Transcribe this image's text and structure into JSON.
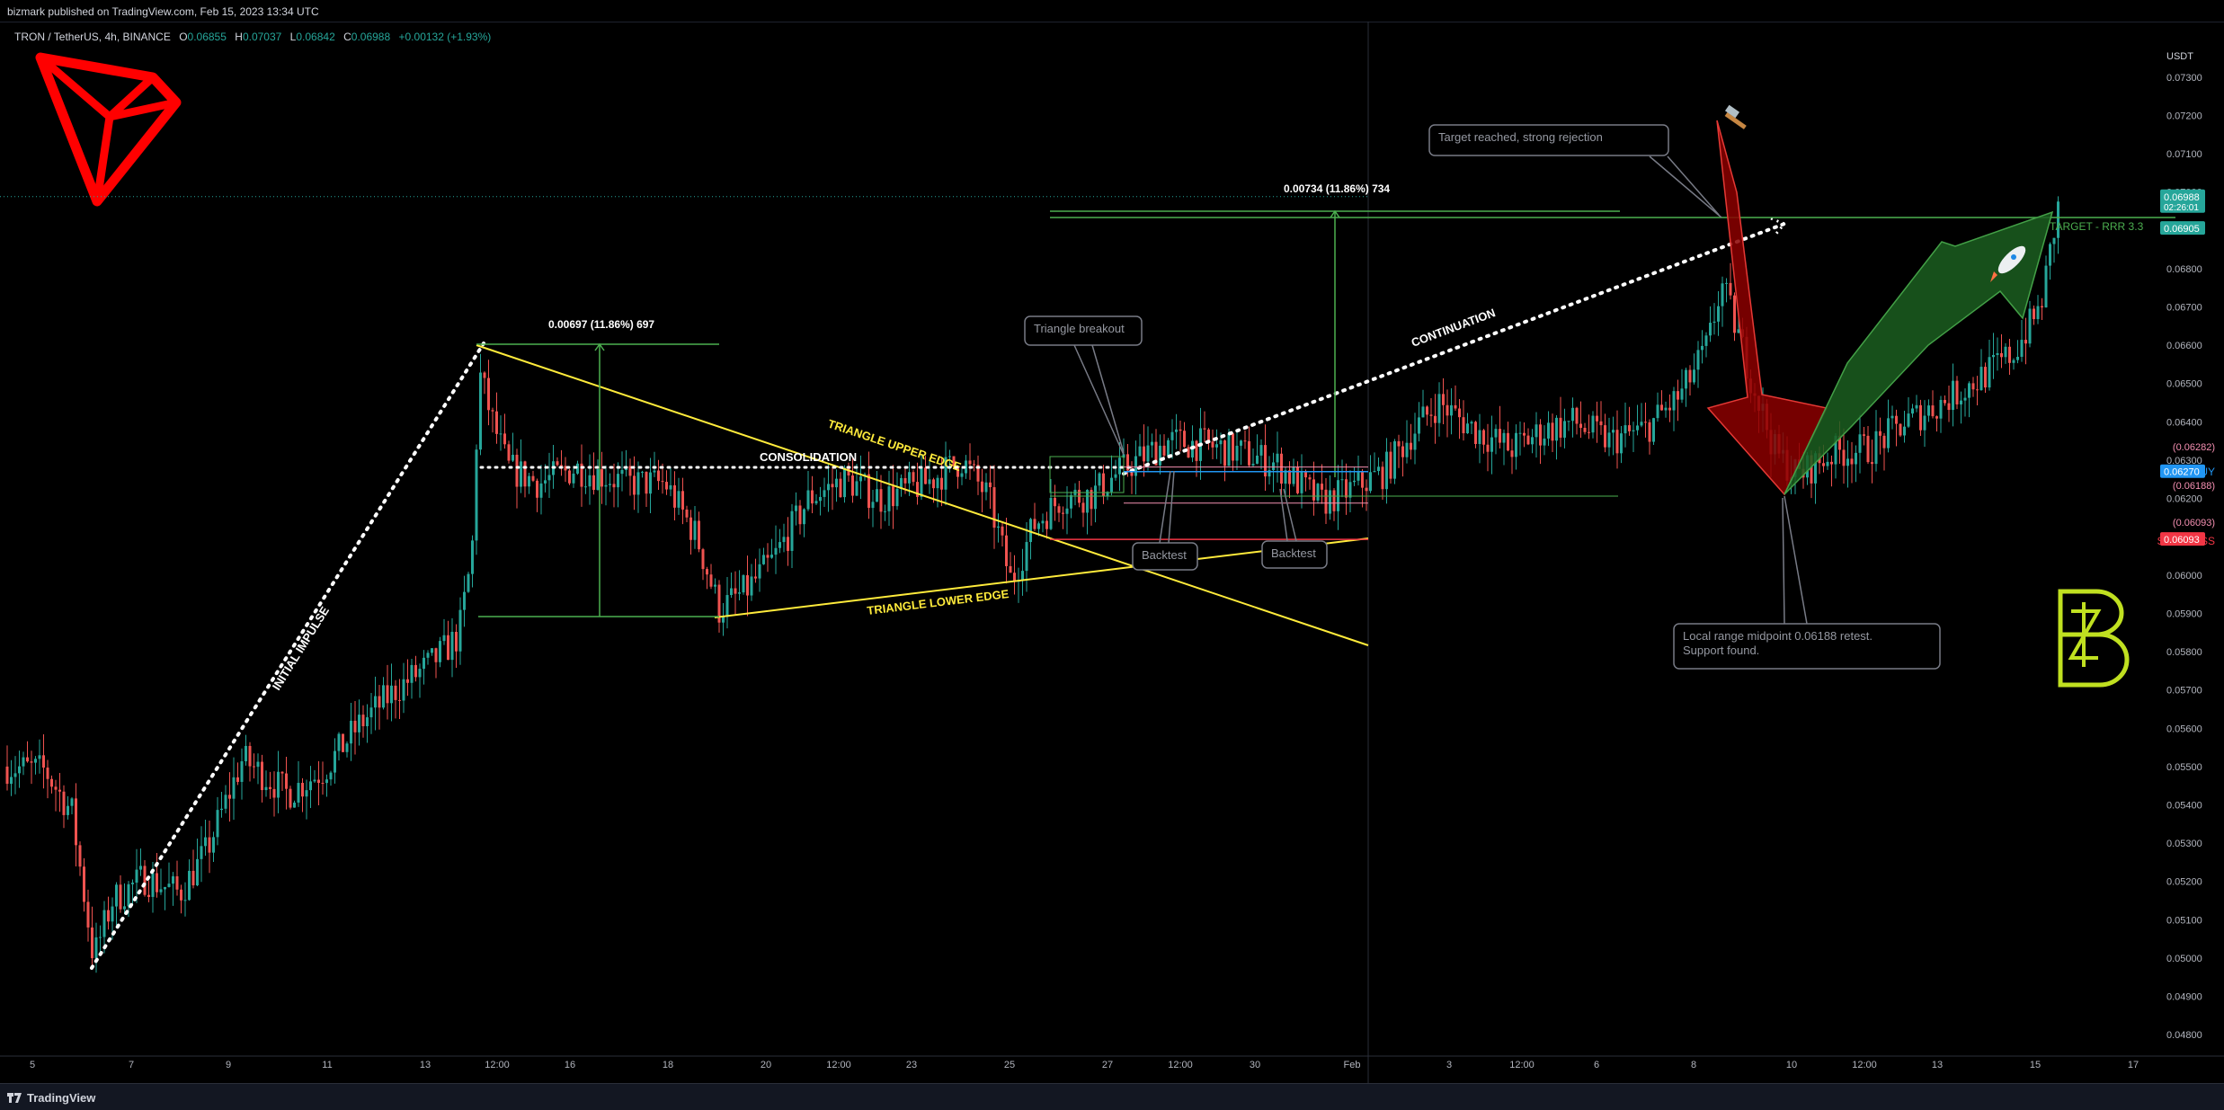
{
  "header": {
    "published": "bizmark published on TradingView.com, Feb 15, 2023 13:34 UTC"
  },
  "symbol_bar": {
    "symbol": "TRON / TetherUS, 4h, BINANCE",
    "open_label": "O",
    "open": "0.06855",
    "high_label": "H",
    "high": "0.07037",
    "low_label": "L",
    "low": "0.06842",
    "close_label": "C",
    "close": "0.06988",
    "change": "+0.00132 (+1.93%)"
  },
  "footer": {
    "brand": "TradingView"
  },
  "colors": {
    "up": "#26a69a",
    "down": "#ef5350",
    "background": "#000000",
    "trendline": "#ffeb3b",
    "target": "#4caf50",
    "buy": "#2196f3",
    "stop": "#f23645",
    "logo": "#ff0000",
    "watermark": "#c0e020"
  },
  "icons": {
    "logo": "tron-logo",
    "hammer": "hammer-icon",
    "rocket": "rocket-icon",
    "watermark": "bizmark-watermark"
  },
  "chart_data": {
    "type": "candlestick",
    "currency": "USDT",
    "y_axis": {
      "ylim": [
        0.0477,
        0.07445
      ],
      "ticks": [
        "0.07300",
        "0.07200",
        "0.07100",
        "0.07000",
        "0.06900",
        "0.06800",
        "0.06700",
        "0.06600",
        "0.06500",
        "0.06400",
        "0.06300",
        "0.06200",
        "0.06100",
        "0.06000",
        "0.05900",
        "0.05800",
        "0.05700",
        "0.05600",
        "0.05500",
        "0.05400",
        "0.05300",
        "0.05200",
        "0.05100",
        "0.05000",
        "0.04900",
        "0.04800"
      ]
    },
    "x_axis": {
      "labels": [
        "5",
        "7",
        "9",
        "11",
        "13",
        "12:00",
        "16",
        "18",
        "20",
        "12:00",
        "23",
        "25",
        "27",
        "12:00",
        "30",
        "Feb",
        "3",
        "12:00",
        "6",
        "8",
        "10",
        "12:00",
        "13",
        "15",
        "17"
      ],
      "label_positions": [
        36,
        146,
        254,
        364,
        473,
        553,
        634,
        743,
        852,
        933,
        1014,
        1123,
        1232,
        1313,
        1396,
        1504,
        1612,
        1693,
        1776,
        1884,
        1993,
        2074,
        2155,
        2264,
        2373
      ]
    },
    "price_tags": [
      {
        "text": "0.06988",
        "sub": "02:26:01",
        "price": 0.06988,
        "color": "#26a69a"
      },
      {
        "text": "0.06905",
        "price": 0.06905,
        "color": "#26a69a"
      },
      {
        "text": "0.06270",
        "price": 0.0627,
        "color": "#2196f3"
      },
      {
        "text": "0.06093",
        "price": 0.06093,
        "color": "#f23645"
      }
    ],
    "levels": [
      {
        "label": "TARGET - RRR 3.3",
        "price": 0.06905
      },
      {
        "label": "(0.06282)",
        "price": 0.06282
      },
      {
        "label": "BUY",
        "price": 0.0627
      },
      {
        "label": "(0.06188)",
        "price": 0.06188
      },
      {
        "label": "(0.06093)",
        "price": 0.06093
      },
      {
        "label": "STOPLOSS",
        "price": 0.06093
      }
    ],
    "annotations": {
      "impulse": "INITIAL IMPULSE",
      "consolidation": "CONSOLIDATION",
      "upper_edge": "TRIANGLE UPPER EDGE",
      "lower_edge": "TRIANGLE LOWER EDGE",
      "continuation": "CONTINUATION",
      "measure1": "0.00697 (11.86%) 697",
      "measure2": "0.00734 (11.86%) 734",
      "breakout": "Triangle breakout",
      "backtest1": "Backtest",
      "backtest2": "Backtest",
      "target_reached": "Target reached, strong rejection",
      "retest_line1": "Local range midpoint 0.06188 retest.",
      "retest_line2": "Support found."
    },
    "path": [
      {
        "x": 8,
        "p": 0.055
      },
      {
        "x": 50,
        "p": 0.0549
      },
      {
        "x": 80,
        "p": 0.0538
      },
      {
        "x": 104,
        "p": 0.05
      },
      {
        "x": 125,
        "p": 0.0515
      },
      {
        "x": 160,
        "p": 0.0521
      },
      {
        "x": 200,
        "p": 0.0517
      },
      {
        "x": 230,
        "p": 0.0528
      },
      {
        "x": 270,
        "p": 0.0552
      },
      {
        "x": 320,
        "p": 0.0543
      },
      {
        "x": 360,
        "p": 0.0549
      },
      {
        "x": 400,
        "p": 0.0561
      },
      {
        "x": 440,
        "p": 0.057
      },
      {
        "x": 480,
        "p": 0.0577
      },
      {
        "x": 510,
        "p": 0.0584
      },
      {
        "x": 525,
        "p": 0.0605
      },
      {
        "x": 533,
        "p": 0.0653
      },
      {
        "x": 548,
        "p": 0.064
      },
      {
        "x": 565,
        "p": 0.0628
      },
      {
        "x": 600,
        "p": 0.0624
      },
      {
        "x": 640,
        "p": 0.0628
      },
      {
        "x": 700,
        "p": 0.0624
      },
      {
        "x": 740,
        "p": 0.0624
      },
      {
        "x": 775,
        "p": 0.061
      },
      {
        "x": 800,
        "p": 0.0591
      },
      {
        "x": 830,
        "p": 0.0596
      },
      {
        "x": 860,
        "p": 0.0604
      },
      {
        "x": 900,
        "p": 0.062
      },
      {
        "x": 940,
        "p": 0.0625
      },
      {
        "x": 980,
        "p": 0.062
      },
      {
        "x": 1030,
        "p": 0.0624
      },
      {
        "x": 1070,
        "p": 0.063
      },
      {
        "x": 1100,
        "p": 0.062
      },
      {
        "x": 1125,
        "p": 0.0598
      },
      {
        "x": 1150,
        "p": 0.0613
      },
      {
        "x": 1180,
        "p": 0.062
      },
      {
        "x": 1215,
        "p": 0.0621
      },
      {
        "x": 1240,
        "p": 0.0626
      },
      {
        "x": 1265,
        "p": 0.063
      },
      {
        "x": 1300,
        "p": 0.0635
      },
      {
        "x": 1340,
        "p": 0.0634
      },
      {
        "x": 1380,
        "p": 0.0632
      },
      {
        "x": 1420,
        "p": 0.0629
      },
      {
        "x": 1440,
        "p": 0.0625
      },
      {
        "x": 1470,
        "p": 0.0619
      },
      {
        "x": 1500,
        "p": 0.0622
      },
      {
        "x": 1540,
        "p": 0.0627
      },
      {
        "x": 1570,
        "p": 0.0637
      },
      {
        "x": 1600,
        "p": 0.0645
      },
      {
        "x": 1640,
        "p": 0.0638
      },
      {
        "x": 1680,
        "p": 0.0633
      },
      {
        "x": 1720,
        "p": 0.0638
      },
      {
        "x": 1750,
        "p": 0.064
      },
      {
        "x": 1790,
        "p": 0.0635
      },
      {
        "x": 1830,
        "p": 0.0638
      },
      {
        "x": 1870,
        "p": 0.0647
      },
      {
        "x": 1900,
        "p": 0.066
      },
      {
        "x": 1915,
        "p": 0.0676
      },
      {
        "x": 1932,
        "p": 0.0664
      },
      {
        "x": 1950,
        "p": 0.065
      },
      {
        "x": 1975,
        "p": 0.0632
      },
      {
        "x": 2000,
        "p": 0.0626
      },
      {
        "x": 2040,
        "p": 0.0632
      },
      {
        "x": 2080,
        "p": 0.0633
      },
      {
        "x": 2120,
        "p": 0.064
      },
      {
        "x": 2160,
        "p": 0.0645
      },
      {
        "x": 2200,
        "p": 0.0651
      },
      {
        "x": 2240,
        "p": 0.0658
      },
      {
        "x": 2270,
        "p": 0.067
      },
      {
        "x": 2285,
        "p": 0.069
      },
      {
        "x": 2292,
        "p": 0.06988
      }
    ]
  }
}
